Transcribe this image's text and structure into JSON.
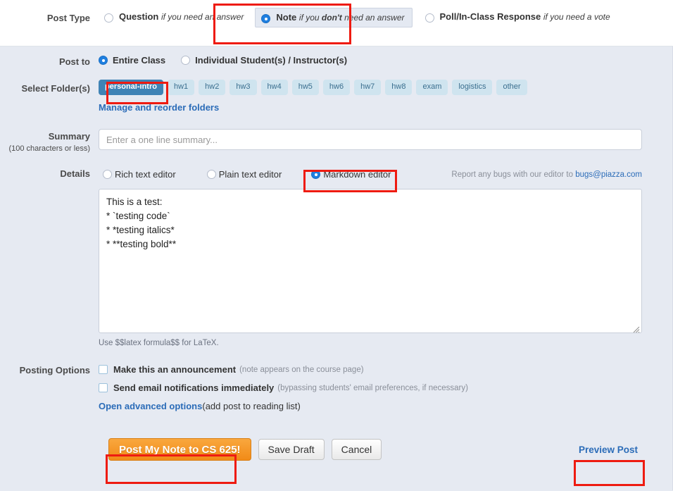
{
  "post_type": {
    "label": "Post Type",
    "options": [
      {
        "title": "Question",
        "sub_prefix": "if you need an answer",
        "sub_bold": "",
        "sub_suffix": "",
        "selected": false
      },
      {
        "title": "Note",
        "sub_prefix": "if you ",
        "sub_bold": "don't",
        "sub_suffix": " need an answer",
        "selected": true
      },
      {
        "title": "Poll/In-Class Response",
        "sub_prefix": "if you need a vote",
        "sub_bold": "",
        "sub_suffix": "",
        "selected": false
      }
    ]
  },
  "post_to": {
    "label": "Post to",
    "options": [
      {
        "label": "Entire Class",
        "selected": true
      },
      {
        "label": "Individual Student(s) / Instructor(s)",
        "selected": false
      }
    ]
  },
  "folders": {
    "label": "Select Folder(s)",
    "tags": [
      {
        "name": "personal-intro",
        "selected": true
      },
      {
        "name": "hw1",
        "selected": false
      },
      {
        "name": "hw2",
        "selected": false
      },
      {
        "name": "hw3",
        "selected": false
      },
      {
        "name": "hw4",
        "selected": false
      },
      {
        "name": "hw5",
        "selected": false
      },
      {
        "name": "hw6",
        "selected": false
      },
      {
        "name": "hw7",
        "selected": false
      },
      {
        "name": "hw8",
        "selected": false
      },
      {
        "name": "exam",
        "selected": false
      },
      {
        "name": "logistics",
        "selected": false
      },
      {
        "name": "other",
        "selected": false
      }
    ],
    "manage_link": "Manage and reorder folders"
  },
  "summary": {
    "label": "Summary",
    "sub_label": "(100 characters or less)",
    "placeholder": "Enter a one line summary...",
    "value": ""
  },
  "details": {
    "label": "Details",
    "editors": [
      {
        "label": "Rich text editor",
        "selected": false
      },
      {
        "label": "Plain text editor",
        "selected": false
      },
      {
        "label": "Markdown editor",
        "selected": true
      }
    ],
    "bugs_text": "Report any bugs with our editor to ",
    "bugs_email": "bugs@piazza.com",
    "body": "This is a test:\n* `testing code`\n* *testing italics*\n* **testing bold**",
    "latex_hint": "Use $$latex formula$$ for LaTeX."
  },
  "posting_options": {
    "label": "Posting Options",
    "items": [
      {
        "label": "Make this an announcement",
        "note": "(note appears on the course page)",
        "checked": false
      },
      {
        "label": "Send email notifications immediately",
        "note": "(bypassing students' email preferences, if necessary)",
        "checked": false
      }
    ],
    "advanced_link": "Open advanced options",
    "advanced_note": "(add post to reading list)"
  },
  "actions": {
    "submit": "Post My Note to CS 625!",
    "save_draft": "Save Draft",
    "cancel": "Cancel",
    "preview": "Preview Post"
  },
  "colors": {
    "accent_blue": "#1f7fe0",
    "link_blue": "#2b6cb8",
    "tag_selected": "#3f83b5",
    "tag_unselected": "#cfe4ef",
    "primary_orange": "#f18b17",
    "annotation_red": "#ee1b11",
    "page_background": "#e6eaf2"
  }
}
